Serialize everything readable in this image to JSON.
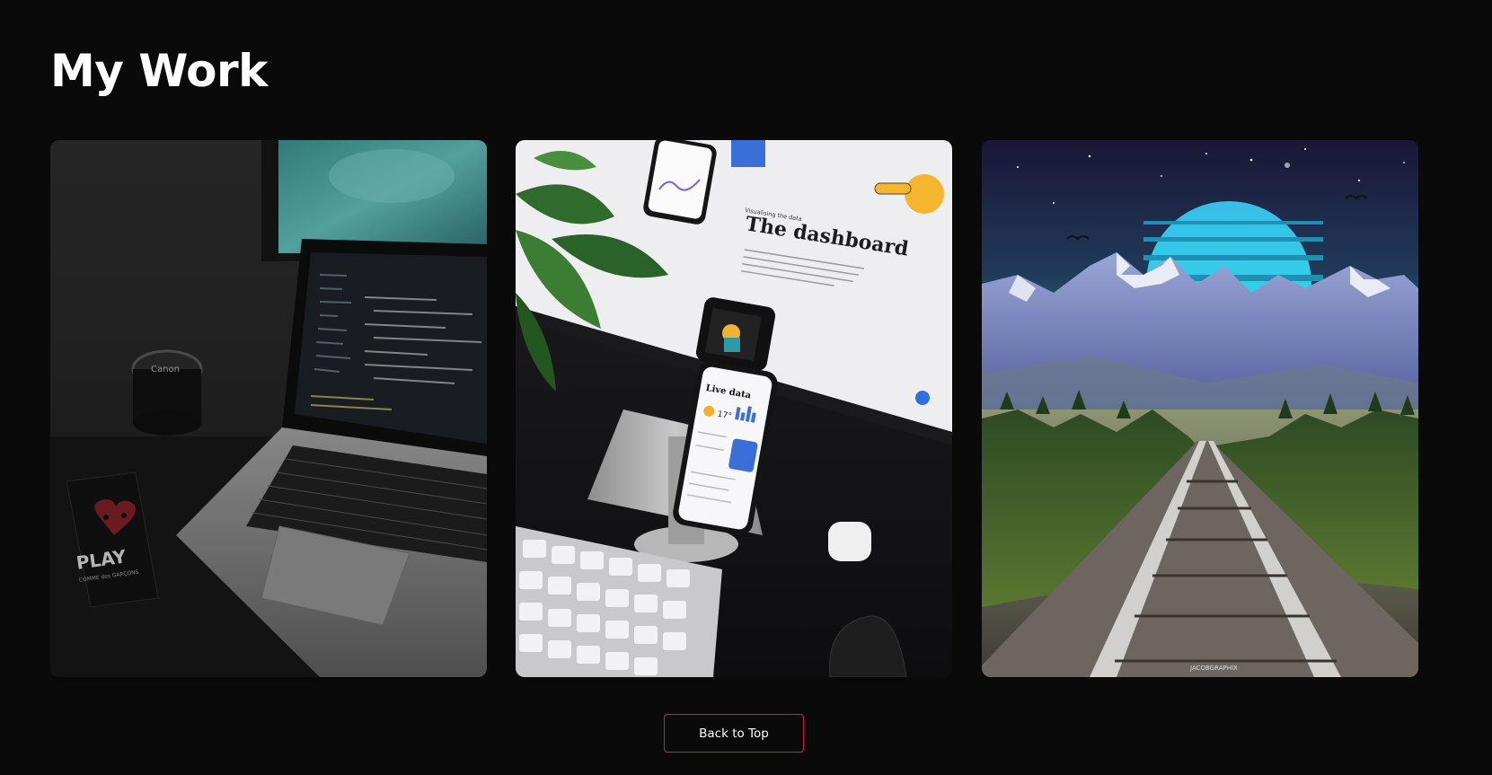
{
  "section": {
    "title": "My Work"
  },
  "portfolio": {
    "items": [
      {
        "name": "Laptop with code editor",
        "subject": "laptop-code-workspace",
        "sticker_text": "PLAY",
        "sticker_subtext": "COMME des GARÇONS",
        "lens_text": "Canon"
      },
      {
        "name": "Dashboard app mockup",
        "subject": "dashboard-app-mockup",
        "screen_heading": "The dashboard",
        "screen_small": "Visualising the data",
        "phone_heading": "Live data",
        "phone_temp": "17°"
      },
      {
        "name": "Synthwave mountains and railway",
        "subject": "synthwave-railway-mountains",
        "signature": "JACOBGRAPHIX"
      }
    ]
  },
  "footer": {
    "back_to_top_label": "Back to Top"
  },
  "colors": {
    "background": "#0a0a0b",
    "accent": "#d41a4f",
    "text": "#ffffff"
  }
}
